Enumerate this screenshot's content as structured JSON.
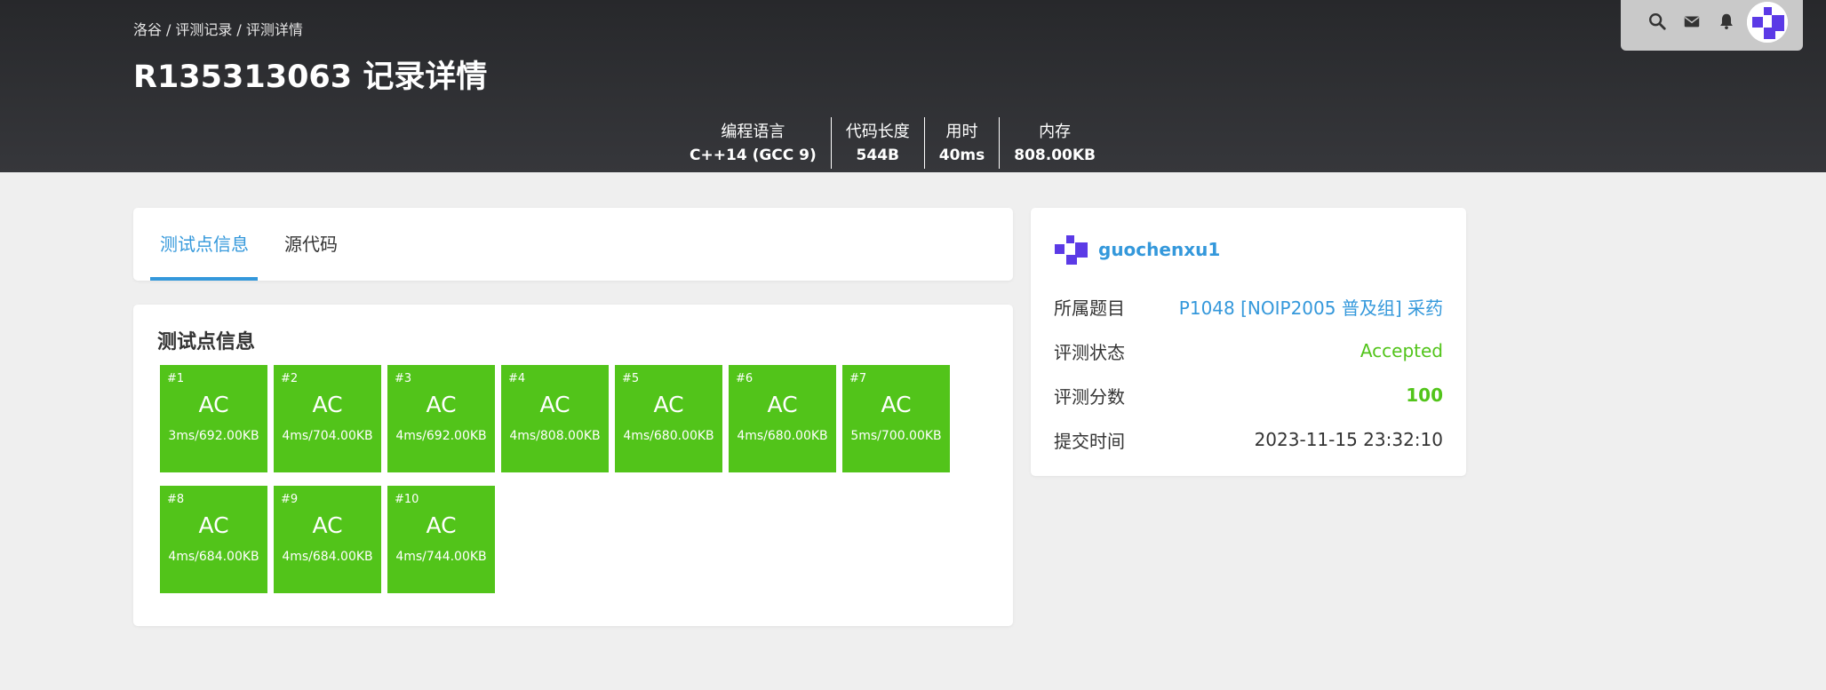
{
  "breadcrumb": [
    "洛谷",
    "评测记录",
    "评测详情"
  ],
  "title": "R135313063 记录详情",
  "stats": [
    {
      "label": "编程语言",
      "value": "C++14 (GCC 9)"
    },
    {
      "label": "代码长度",
      "value": "544B"
    },
    {
      "label": "用时",
      "value": "40ms"
    },
    {
      "label": "内存",
      "value": "808.00KB"
    }
  ],
  "topbar_icons": [
    "search-icon",
    "mail-icon",
    "bell-icon"
  ],
  "tabs": [
    {
      "label": "测试点信息"
    },
    {
      "label": "源代码"
    }
  ],
  "section_title": "测试点信息",
  "testcases": [
    {
      "id": "#1",
      "status": "AC",
      "meta": "3ms/692.00KB"
    },
    {
      "id": "#2",
      "status": "AC",
      "meta": "4ms/704.00KB"
    },
    {
      "id": "#3",
      "status": "AC",
      "meta": "4ms/692.00KB"
    },
    {
      "id": "#4",
      "status": "AC",
      "meta": "4ms/808.00KB"
    },
    {
      "id": "#5",
      "status": "AC",
      "meta": "4ms/680.00KB"
    },
    {
      "id": "#6",
      "status": "AC",
      "meta": "4ms/680.00KB"
    },
    {
      "id": "#7",
      "status": "AC",
      "meta": "5ms/700.00KB"
    },
    {
      "id": "#8",
      "status": "AC",
      "meta": "4ms/684.00KB"
    },
    {
      "id": "#9",
      "status": "AC",
      "meta": "4ms/684.00KB"
    },
    {
      "id": "#10",
      "status": "AC",
      "meta": "4ms/744.00KB"
    }
  ],
  "user": {
    "name": "guochenxu1"
  },
  "info": [
    {
      "key": "所属题目",
      "value": "P1048 [NOIP2005 普及组] 采药"
    },
    {
      "key": "评测状态",
      "value": "Accepted"
    },
    {
      "key": "评测分数",
      "value": "100"
    },
    {
      "key": "提交时间",
      "value": "2023-11-15 23:32:10"
    }
  ],
  "colors": {
    "accent": "#3498db",
    "ac": "#52c41a",
    "header": "#2e2f32",
    "avatar": "#5b3ae6"
  }
}
